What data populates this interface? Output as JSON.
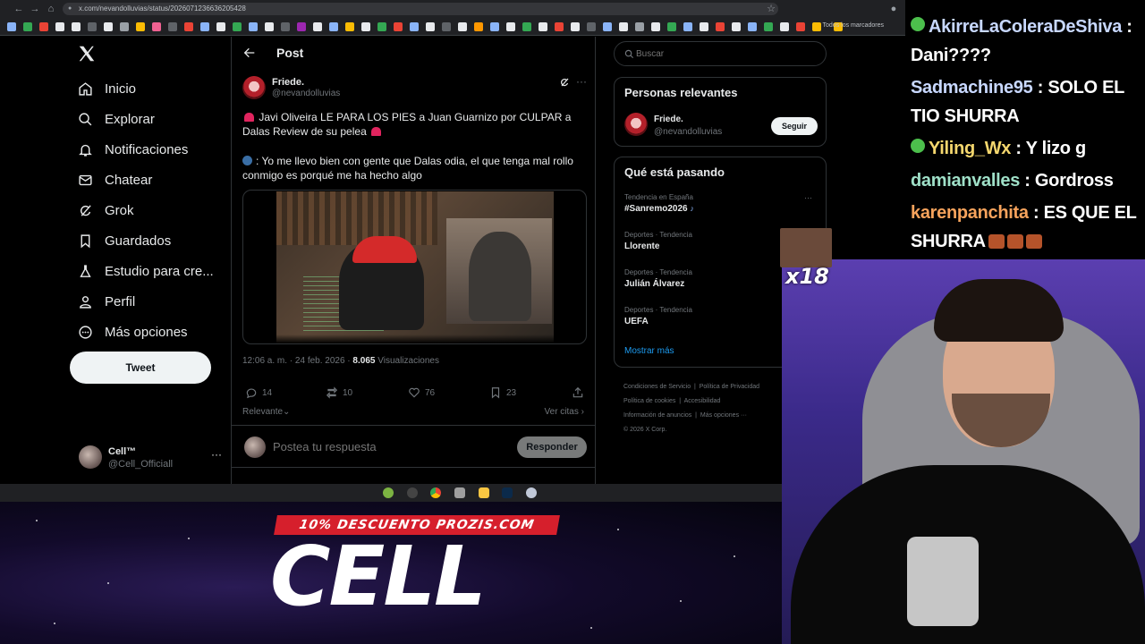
{
  "browser": {
    "url": "x.com/nevandolluvias/status/2026071236636205428",
    "bookmarks_label": "Todos los marcadores"
  },
  "nav": {
    "items": [
      {
        "label": "Inicio",
        "icon": "home-icon"
      },
      {
        "label": "Explorar",
        "icon": "search-icon"
      },
      {
        "label": "Notificaciones",
        "icon": "bell-icon"
      },
      {
        "label": "Chatear",
        "icon": "mail-icon"
      },
      {
        "label": "Grok",
        "icon": "grok-icon"
      },
      {
        "label": "Guardados",
        "icon": "bookmark-icon"
      },
      {
        "label": "Estudio para cre...",
        "icon": "flask-icon"
      },
      {
        "label": "Perfil",
        "icon": "person-icon"
      },
      {
        "label": "Más opciones",
        "icon": "more-circle-icon"
      }
    ],
    "tweet_button": "Tweet",
    "account": {
      "name": "Cell™",
      "handle": "@Cell_Officiall"
    }
  },
  "post": {
    "header_title": "Post",
    "author_name": "Friede.",
    "author_handle": "@nevandolluvias",
    "text1": "Javi Oliveira LE PARA LOS PIES a Juan Guarnizo por CULPAR a Dalas Review de su pelea",
    "text2": ": Yo me llevo bien con gente que Dalas odia, el que tenga mal rollo conmigo es porqué me ha hecho algo",
    "timestamp": "12:06 a. m. · 24 feb. 2026 ·",
    "views_count": "8.065",
    "views_label": "Visualizaciones",
    "replies": "14",
    "reposts": "10",
    "likes": "76",
    "bookmarks": "23",
    "sort_label": "Relevante",
    "quotes_label": "Ver citas",
    "reply_placeholder": "Postea tu respuesta",
    "reply_button": "Responder"
  },
  "sidebar": {
    "search_placeholder": "Buscar",
    "relevant_title": "Personas relevantes",
    "relevant_name": "Friede.",
    "relevant_handle": "@nevandolluvias",
    "follow_button": "Seguir",
    "trends_title": "Qué está pasando",
    "trends": [
      {
        "context": "Tendencia en España",
        "title": "#Sanremo2026"
      },
      {
        "context": "Deportes · Tendencia",
        "title": "Llorente"
      },
      {
        "context": "Deportes · Tendencia",
        "title": "Julián Álvarez"
      },
      {
        "context": "Deportes · Tendencia",
        "title": "UEFA"
      }
    ],
    "show_more": "Mostrar más",
    "footer": [
      "Condiciones de Servicio",
      "Política de Privacidad",
      "Política de cookies",
      "Accesibilidad",
      "Información de anuncios",
      "Más opciones ···",
      "© 2026 X Corp."
    ]
  },
  "stream": {
    "promo": "10% DESCUENTO PROZIS.COM",
    "title": "CELL",
    "emote_multiplier": "x18",
    "chat": [
      {
        "user": "AkirreLaColeraDeShiva",
        "msg": " : Dani????"
      },
      {
        "user": "Sadmachine95",
        "msg": " : SOLO EL TIO SHURRA"
      },
      {
        "user": "Yiling_Wx",
        "msg": " : Y lizo g"
      },
      {
        "user": "damianvalles",
        "msg": " : Gordross"
      },
      {
        "user": "karenpanchita",
        "msg": " : ES QUE EL SHURRA"
      }
    ]
  },
  "colors": {
    "accent": "#1d9bf0",
    "promo_red": "#d61f2c",
    "text_primary": "#e7e9ea",
    "text_secondary": "#71767b"
  }
}
